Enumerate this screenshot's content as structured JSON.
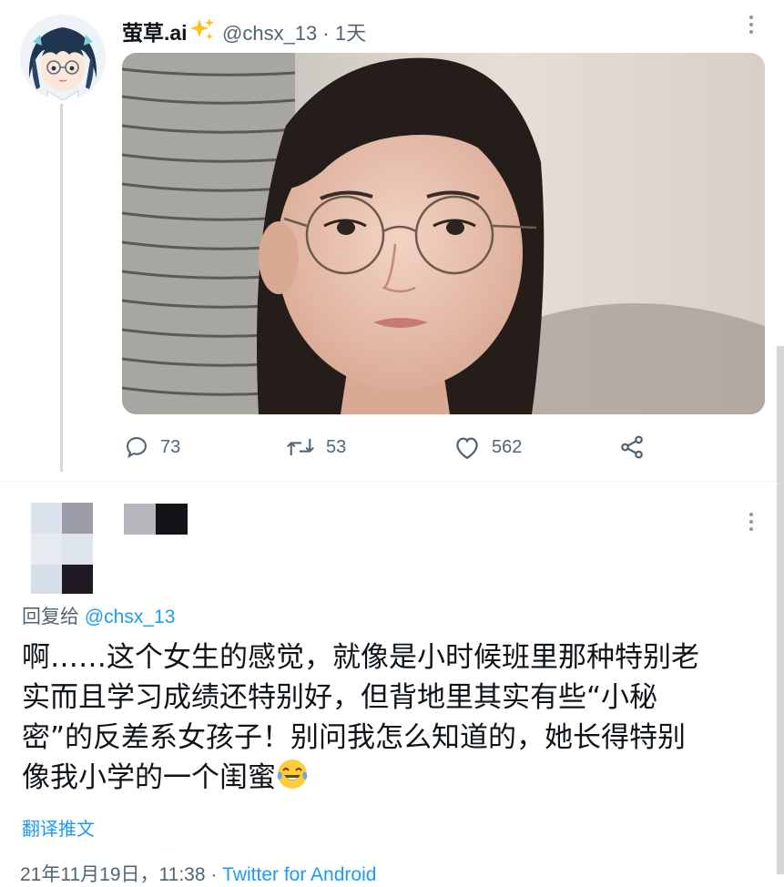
{
  "tweet": {
    "display_name": "萤草.ai",
    "handle": "@chsx_13",
    "separator": "·",
    "time_ago": "1天",
    "actions": {
      "reply_count": "73",
      "retweet_count": "53",
      "like_count": "562"
    },
    "icons": [
      "sparkles-emoji",
      "more-icon",
      "reply-icon",
      "retweet-icon",
      "like-icon",
      "share-icon"
    ]
  },
  "reply": {
    "replying_to_label": "回复给",
    "replying_to_handle": "@chsx_13",
    "text_lines": [
      "啊……这个女生的感觉，就像是小时候班里那种特别老",
      "实而且学习成绩还特别好，但背地里其实有些“小秘",
      "密”的反差系女孩子！别问我怎么知道的，她长得特别",
      "像我小学的一个闺蜜"
    ],
    "emoji": "tears-of-joy-emoji",
    "translate_label": "翻译推文",
    "timestamp": "21年11月19日 · 11:38",
    "timestamp_partial": "21年11月19日，11:38 · ",
    "client": "Twitter for Android"
  },
  "colors": {
    "link_blue": "#1d9bf0",
    "secondary_text": "#536471",
    "primary_text": "#0f1419",
    "thread_line": "#cfd9de"
  }
}
